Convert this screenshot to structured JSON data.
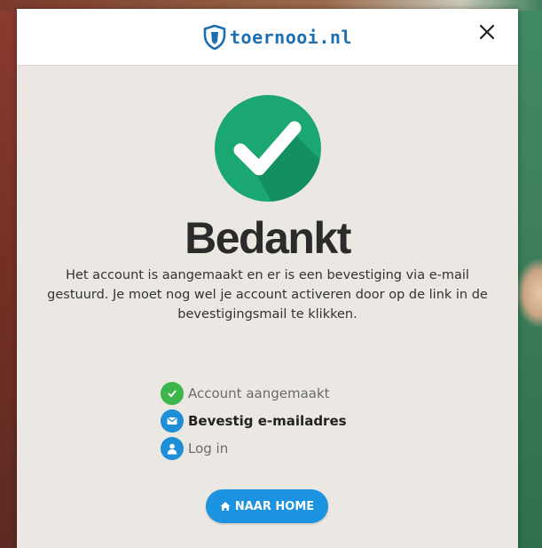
{
  "header": {
    "logo_text": "toernooi.nl",
    "close_icon": "close-icon"
  },
  "main": {
    "icon": "check-circle-icon",
    "title": "Bedankt",
    "message": "Het account is aangemaakt en er is een bevestiging via e-mail gestuurd. Je moet nog wel je account activeren door op de link in de bevestigingsmail te klikken."
  },
  "steps": [
    {
      "label": "Account aangemaakt",
      "state": "done",
      "icon": "check-icon"
    },
    {
      "label": "Bevestig e-mailadres",
      "state": "current",
      "icon": "envelope-icon"
    },
    {
      "label": "Log in",
      "state": "todo",
      "icon": "user-icon"
    }
  ],
  "home_button": {
    "label": "NAAR HOME",
    "icon": "home-icon"
  },
  "colors": {
    "brand": "#1d6fb0",
    "success": "#1aa772",
    "step_done": "#3cb54a",
    "step_active": "#1e8fd6",
    "button": "#1c93e0"
  }
}
